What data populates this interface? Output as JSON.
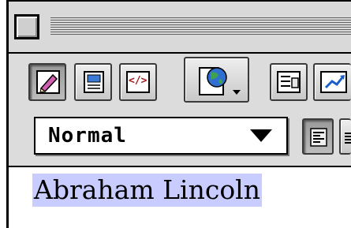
{
  "window": {
    "title": ""
  },
  "toolbar": {
    "buttons": [
      {
        "id": "edit-mode",
        "icon": "pencil-icon",
        "pressed": true
      },
      {
        "id": "preview-mode",
        "icon": "page-preview-icon",
        "pressed": false
      },
      {
        "id": "html-source",
        "icon": "html-tags-icon",
        "label": "</>",
        "pressed": false
      },
      {
        "id": "globe-menu",
        "icon": "globe-page-icon",
        "pressed": false
      },
      {
        "id": "insert-form",
        "icon": "form-icon",
        "pressed": false
      },
      {
        "id": "insert-link",
        "icon": "link-arrow-icon",
        "pressed": false
      }
    ],
    "format_select": {
      "value": "Normal"
    },
    "align_left": {
      "icon": "align-left-icon"
    }
  },
  "document": {
    "text": "Abraham Lincoln",
    "selection_color": "#c8ccff"
  }
}
